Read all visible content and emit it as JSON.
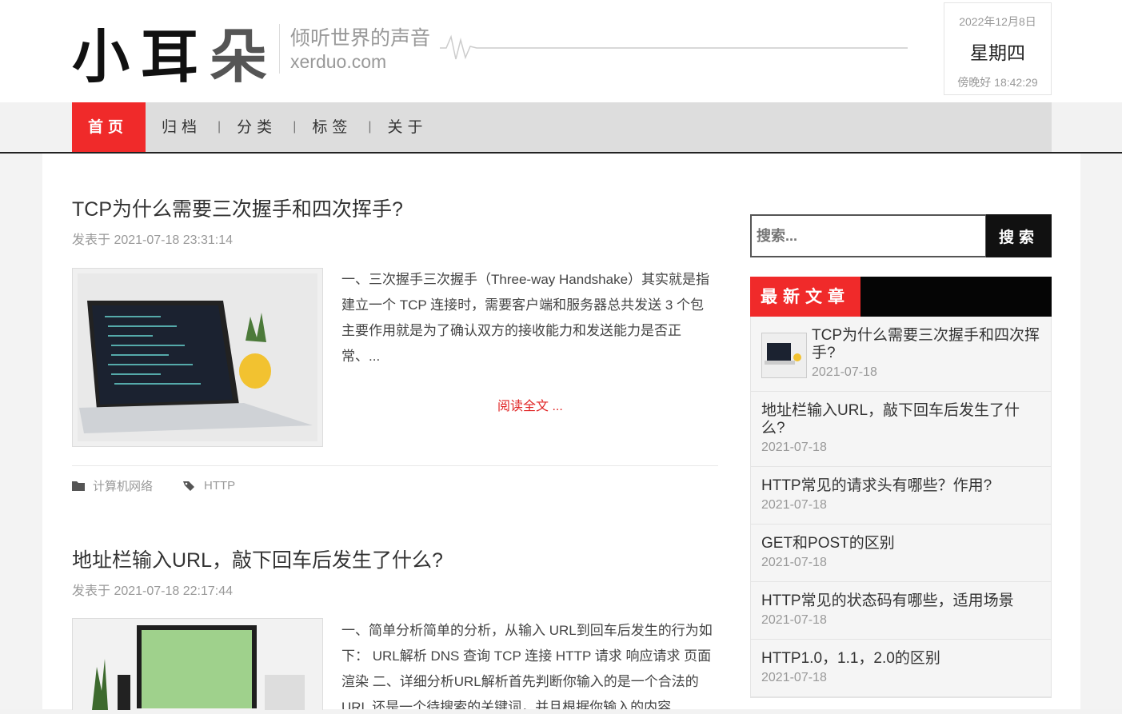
{
  "header": {
    "tagline": "倾听世界的声音",
    "domain": "xerduo.com",
    "date": "2022年12月8日",
    "weekday": "星期四",
    "greeting_time": "傍晚好 18:42:29"
  },
  "nav": {
    "items": [
      "首页",
      "归档",
      "分类",
      "标签",
      "关于"
    ],
    "active_index": 0
  },
  "posts": [
    {
      "title": "TCP为什么需要三次握手和四次挥手?",
      "meta": "发表于 2021-07-18 23:31:14",
      "excerpt": "一、三次握手三次握手（Three-way Handshake）其实就是指建立一个 TCP 连接时，需要客户端和服务器总共发送 3 个包 主要作用就是为了确认双方的接收能力和发送能力是否正常、...",
      "read_more": "阅读全文 ...",
      "category": "计算机网络",
      "tag": "HTTP"
    },
    {
      "title": "地址栏输入URL，敲下回车后发生了什么?",
      "meta": "发表于 2021-07-18 22:17:44",
      "excerpt": "一、简单分析简单的分析，从输入 URL到回车后发生的行为如下： URL解析 DNS 查询 TCP 连接 HTTP 请求 响应请求 页面渲染 二、详细分析URL解析首先判断你输入的是一个合法的 URL 还是一个待搜索的关键词，并且根据你输入的内容"
    }
  ],
  "sidebar": {
    "search_placeholder": "搜索...",
    "search_button": "搜索",
    "recent_title": "最新文章",
    "recent": [
      {
        "title": "TCP为什么需要三次握手和四次挥手?",
        "date": "2021-07-18"
      },
      {
        "title": "地址栏输入URL，敲下回车后发生了什么?",
        "date": "2021-07-18"
      },
      {
        "title": "HTTP常见的请求头有哪些？作用?",
        "date": "2021-07-18"
      },
      {
        "title": "GET和POST的区别",
        "date": "2021-07-18"
      },
      {
        "title": "HTTP常见的状态码有哪些，适用场景",
        "date": "2021-07-18"
      },
      {
        "title": "HTTP1.0，1.1，2.0的区别",
        "date": "2021-07-18"
      }
    ]
  },
  "colors": {
    "accent": "#f02a2a",
    "dark": "#050505"
  },
  "logo_text": "小耳朵"
}
